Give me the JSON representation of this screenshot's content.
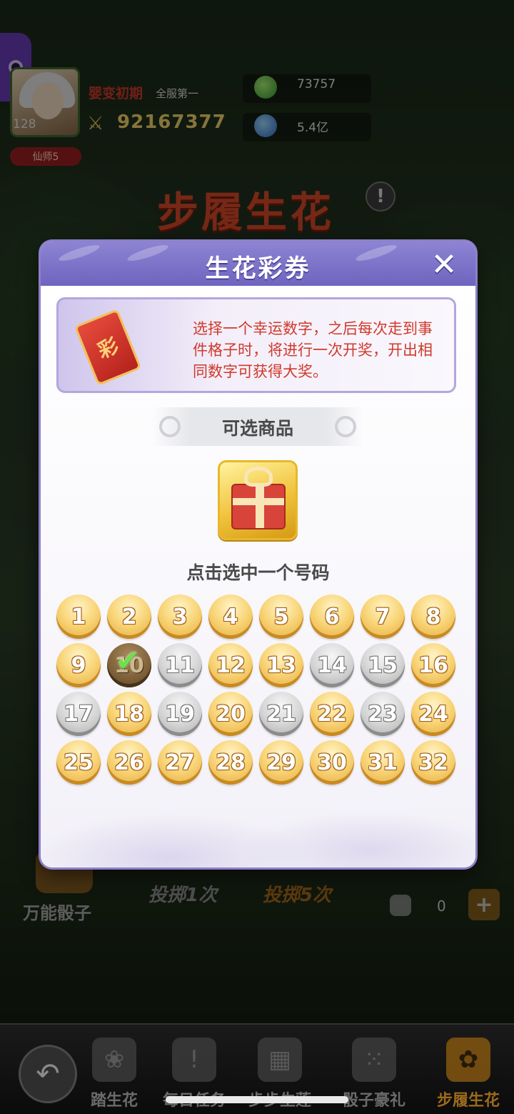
{
  "player": {
    "level": "128",
    "rank_badge": "仙师5",
    "realm": "婴变初期",
    "server_rank": "全服第一",
    "power": "92167377"
  },
  "resources": [
    {
      "icon": "green-coin-icon",
      "value": "73757"
    },
    {
      "icon": "blue-gem-icon",
      "value": "5.4亿"
    }
  ],
  "stage": {
    "title": "步履生花",
    "help_icon": "!"
  },
  "modal": {
    "title": "生花彩券",
    "close_icon": "✕",
    "description": "选择一个幸运数字，之后每次走到事件格子时，将进行一次开奖，开出相同数字可获得大奖。",
    "ticket_char": "彩",
    "section_title": "可选商品",
    "hint": "点击选中一个号码",
    "numbers": [
      {
        "n": "1",
        "state": "gold"
      },
      {
        "n": "2",
        "state": "gold"
      },
      {
        "n": "3",
        "state": "gold"
      },
      {
        "n": "4",
        "state": "gold"
      },
      {
        "n": "5",
        "state": "gold"
      },
      {
        "n": "6",
        "state": "gold"
      },
      {
        "n": "7",
        "state": "gold"
      },
      {
        "n": "8",
        "state": "gold"
      },
      {
        "n": "9",
        "state": "gold"
      },
      {
        "n": "10",
        "state": "selected"
      },
      {
        "n": "11",
        "state": "gray"
      },
      {
        "n": "12",
        "state": "gold"
      },
      {
        "n": "13",
        "state": "gold"
      },
      {
        "n": "14",
        "state": "gray"
      },
      {
        "n": "15",
        "state": "gray"
      },
      {
        "n": "16",
        "state": "gold"
      },
      {
        "n": "17",
        "state": "gray"
      },
      {
        "n": "18",
        "state": "gold"
      },
      {
        "n": "19",
        "state": "gray"
      },
      {
        "n": "20",
        "state": "gold"
      },
      {
        "n": "21",
        "state": "gray"
      },
      {
        "n": "22",
        "state": "gold"
      },
      {
        "n": "23",
        "state": "gray"
      },
      {
        "n": "24",
        "state": "gold"
      },
      {
        "n": "25",
        "state": "gold"
      },
      {
        "n": "26",
        "state": "gold"
      },
      {
        "n": "27",
        "state": "gold"
      },
      {
        "n": "28",
        "state": "gold"
      },
      {
        "n": "29",
        "state": "gold"
      },
      {
        "n": "30",
        "state": "gold"
      },
      {
        "n": "31",
        "state": "gold"
      },
      {
        "n": "32",
        "state": "gold"
      }
    ]
  },
  "controls": {
    "any_dice_label": "万能骰子",
    "throw_once": "投掷1次",
    "throw_five": "投掷5次",
    "dice_count": "0",
    "plus": "+"
  },
  "nav": {
    "back_icon": "↶",
    "items": [
      {
        "label": "踏生花",
        "icon": "❀",
        "active": false
      },
      {
        "label": "每日任务",
        "icon": "!",
        "active": false
      },
      {
        "label": "步步生莲",
        "icon": "▦",
        "active": false
      },
      {
        "label": "骰子豪礼",
        "icon": "⁙",
        "active": false
      },
      {
        "label": "步履生花",
        "icon": "✿",
        "active": true
      }
    ]
  },
  "colors": {
    "accent": "#7065c0",
    "gold": "#f0c23a",
    "description_red": "#d0392b"
  }
}
